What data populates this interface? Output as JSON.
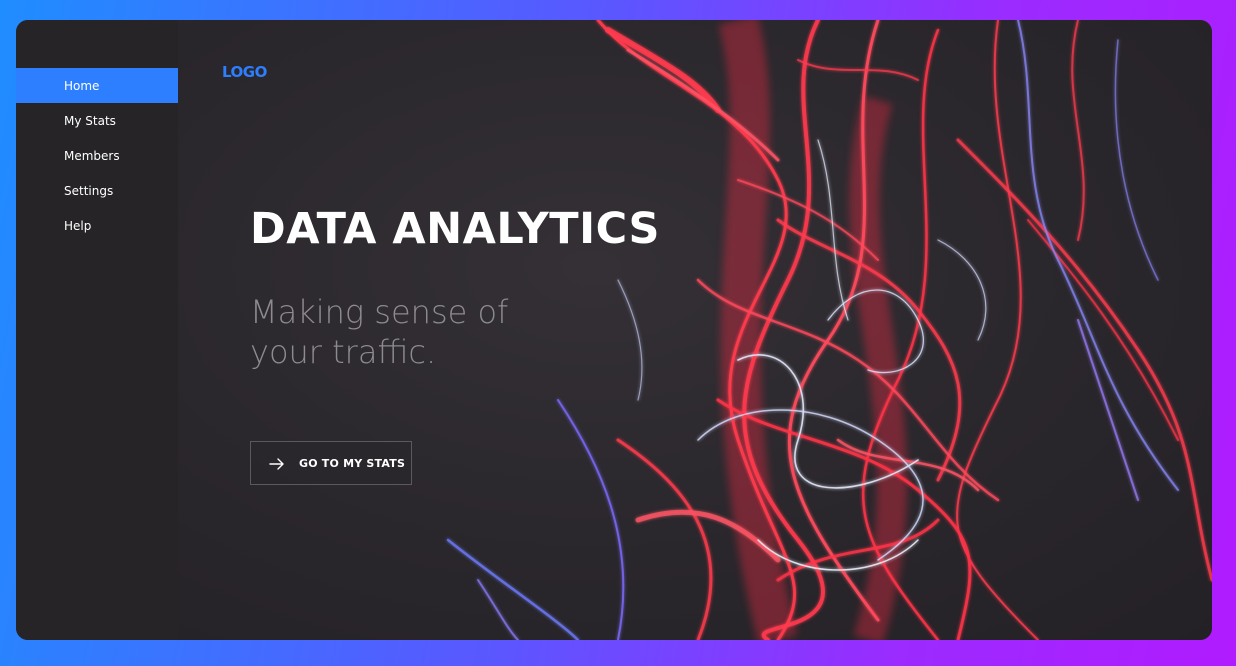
{
  "sidebar": {
    "items": [
      {
        "label": "Home",
        "active": true
      },
      {
        "label": "My Stats",
        "active": false
      },
      {
        "label": "Members",
        "active": false
      },
      {
        "label": "Settings",
        "active": false
      },
      {
        "label": "Help",
        "active": false
      }
    ]
  },
  "header": {
    "logo": "LOGO"
  },
  "hero": {
    "title": "DATA ANALYTICS",
    "subtitle_line1": "Making sense of",
    "subtitle_line2": "your traffic.",
    "cta_label": "GO TO MY STATS",
    "cta_icon": "arrow-right-icon"
  },
  "colors": {
    "accent": "#2d7fff",
    "sidebar_bg": "#262427",
    "main_bg": "#2b282d",
    "light_red": "#ff3b4e",
    "light_blue": "#6f7cff"
  }
}
